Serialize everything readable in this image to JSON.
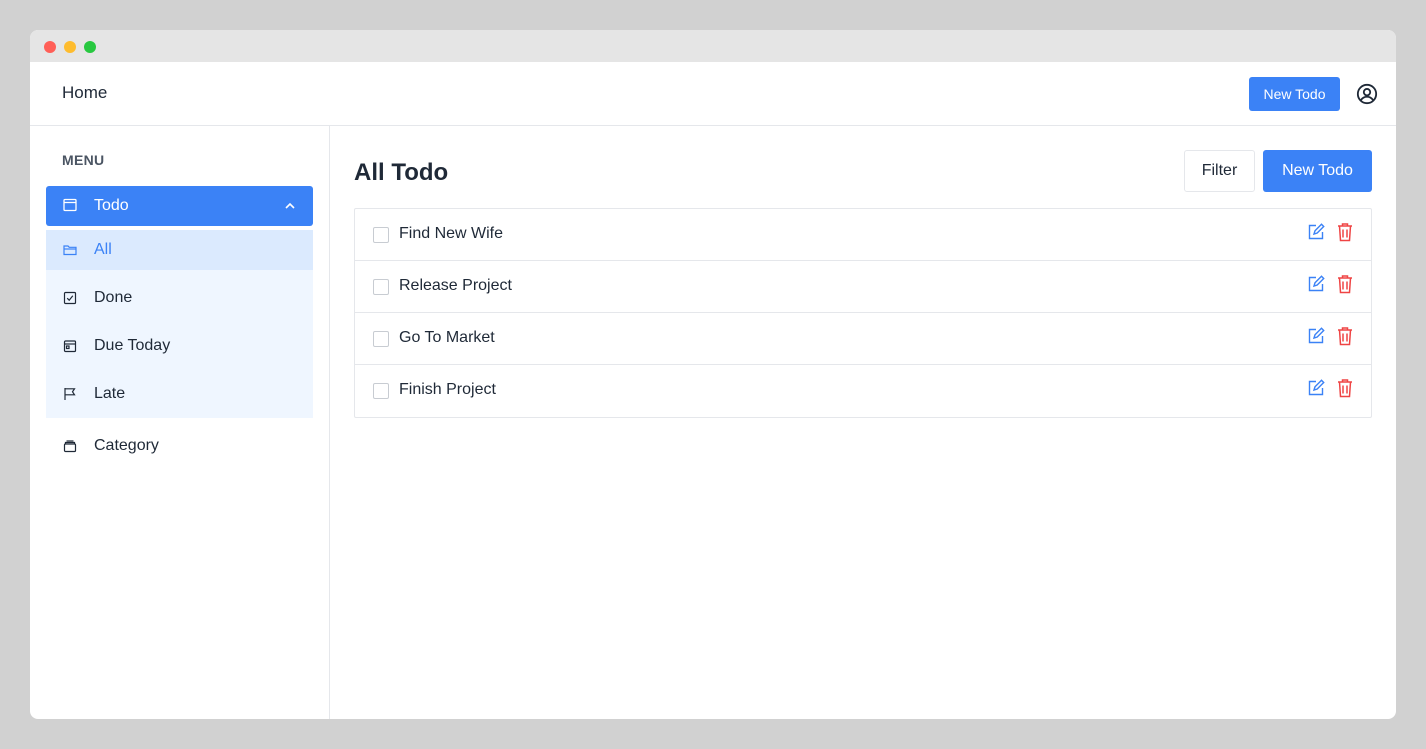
{
  "window": {
    "controls": [
      "close",
      "minimize",
      "maximize"
    ]
  },
  "topbar": {
    "home_label": "Home",
    "new_todo_label": "New Todo",
    "account_icon": "user-circle-icon"
  },
  "sidebar": {
    "heading": "MENU",
    "todo_menu": {
      "label": "Todo",
      "icon": "window-icon",
      "expanded": true
    },
    "submenu": [
      {
        "label": "All",
        "icon": "folder-icon",
        "active": true
      },
      {
        "label": "Done",
        "icon": "checkbox-icon",
        "active": false
      },
      {
        "label": "Due Today",
        "icon": "calendar-icon",
        "active": false
      },
      {
        "label": "Late",
        "icon": "flag-icon",
        "active": false
      }
    ],
    "category": {
      "label": "Category",
      "icon": "archive-icon"
    }
  },
  "main": {
    "title": "All Todo",
    "filter_label": "Filter",
    "new_todo_label": "New Todo",
    "todos": [
      {
        "text": "Find New Wife",
        "done": false
      },
      {
        "text": "Release Project",
        "done": false
      },
      {
        "text": "Go To Market",
        "done": false
      },
      {
        "text": "Finish Project",
        "done": false
      }
    ]
  },
  "colors": {
    "accent": "#3b82f6",
    "active_bg": "#dbeafe",
    "submenu_bg": "#eff6ff",
    "delete": "#ef4444"
  }
}
